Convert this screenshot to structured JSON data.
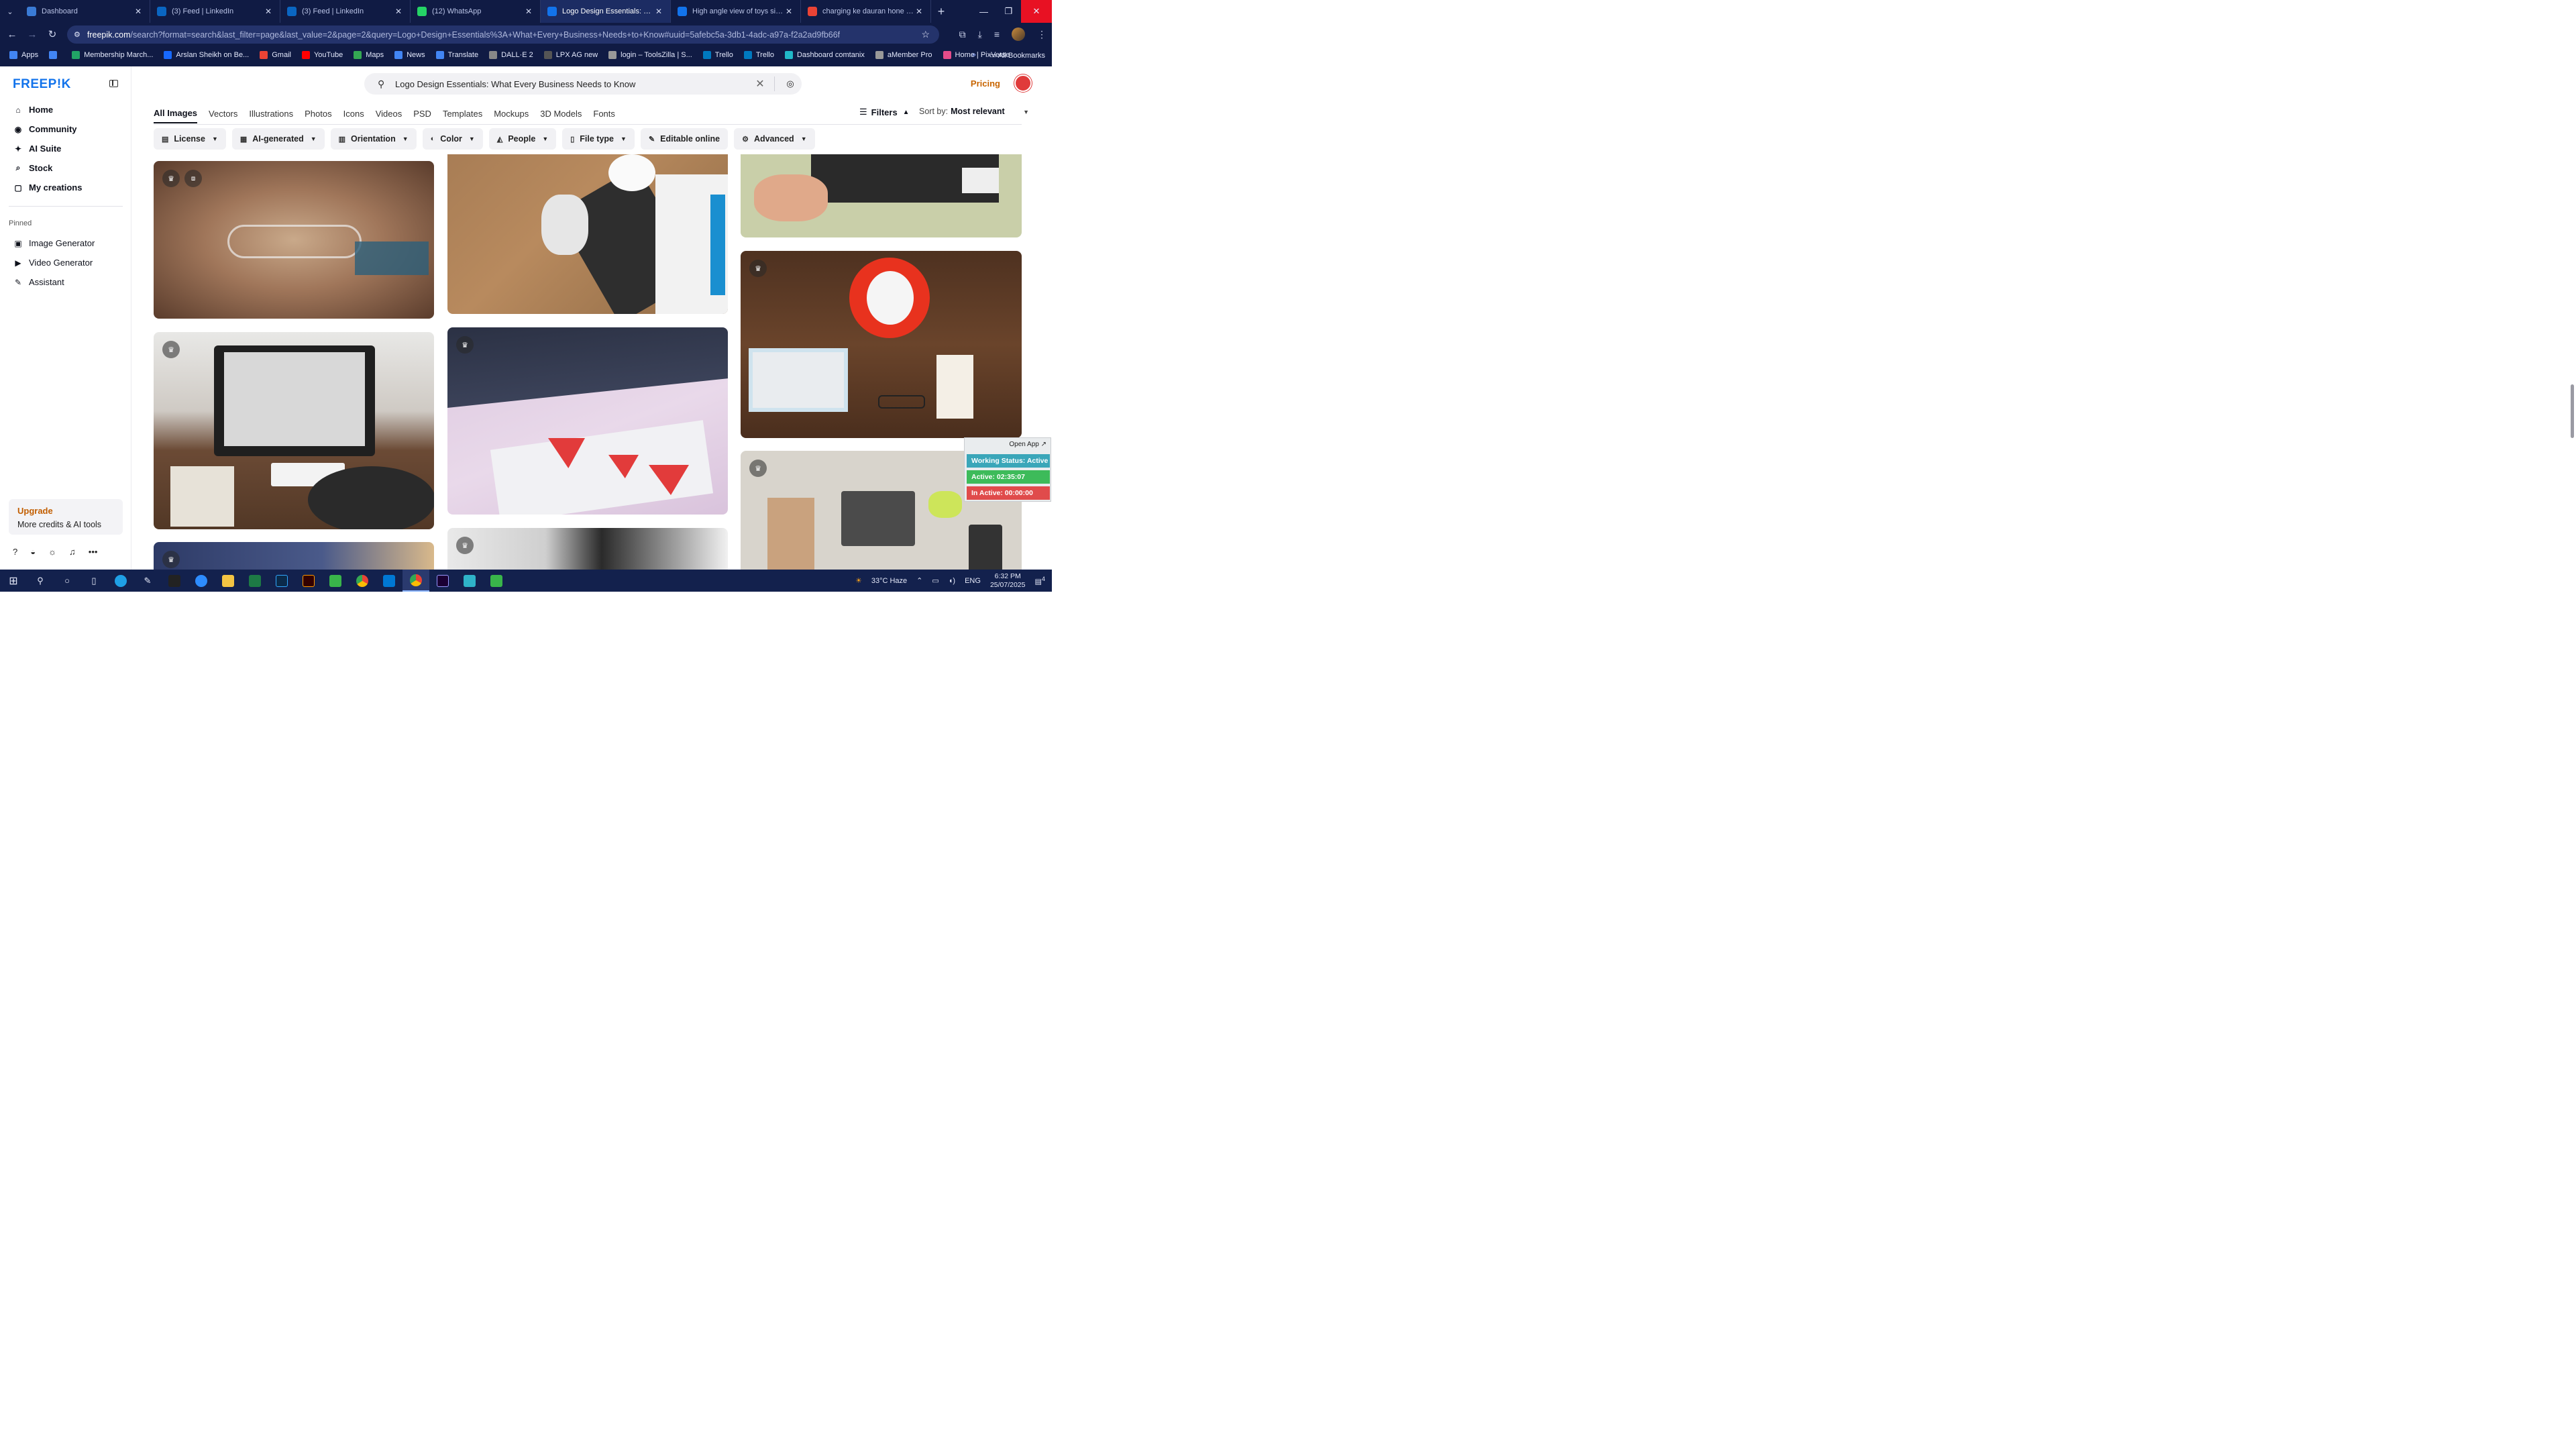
{
  "browser": {
    "tabs": [
      {
        "title": "Dashboard",
        "color": "#3a7bd5"
      },
      {
        "title": "(3) Feed | LinkedIn",
        "color": "#0a66c2"
      },
      {
        "title": "(3) Feed | LinkedIn",
        "color": "#0a66c2"
      },
      {
        "title": "(12) WhatsApp",
        "color": "#25d366"
      },
      {
        "title": "Logo Design Essentials: What Every",
        "color": "#1273eb"
      },
      {
        "title": "High angle view of toys sign | Fr",
        "color": "#1273eb"
      },
      {
        "title": "charging ke dauran hone ka use",
        "color": "#ea4335"
      }
    ],
    "active_tab_index": 4,
    "url_site": "freepik.com",
    "url_rest": "/search?format=search&last_filter=page&last_value=2&page=2&query=Logo+Design+Essentials%3A+What+Every+Business+Needs+to+Know#uuid=5afebc5a-3db1-4adc-a97a-f2a2ad9fb66f",
    "bookmarks": [
      {
        "label": "Apps",
        "color": "#4285f4"
      },
      {
        "label": "",
        "color": "#4285f4"
      },
      {
        "label": "Membership March...",
        "color": "#21a366"
      },
      {
        "label": "Arslan Sheikh on Be...",
        "color": "#1769ff"
      },
      {
        "label": "Gmail",
        "color": "#ea4335"
      },
      {
        "label": "YouTube",
        "color": "#ff0000"
      },
      {
        "label": "Maps",
        "color": "#34a853"
      },
      {
        "label": "News",
        "color": "#4285f4"
      },
      {
        "label": "Translate",
        "color": "#4285f4"
      },
      {
        "label": "DALL·E 2",
        "color": "#888888"
      },
      {
        "label": "LPX AG new",
        "color": "#555555"
      },
      {
        "label": "login – ToolsZilla | S...",
        "color": "#999999"
      },
      {
        "label": "Trello",
        "color": "#0079bf"
      },
      {
        "label": "Trello",
        "color": "#0079bf"
      },
      {
        "label": "Dashboard comtanix",
        "color": "#21b8c8"
      },
      {
        "label": "aMember Pro",
        "color": "#999999"
      },
      {
        "label": "Home | PixVerse",
        "color": "#e44c8a"
      }
    ],
    "all_bookmarks": "All Bookmarks"
  },
  "sidebar": {
    "logo": "FREEP!K",
    "nav": [
      {
        "label": "Home",
        "icon": "⌂"
      },
      {
        "label": "Community",
        "icon": "◉"
      },
      {
        "label": "AI Suite",
        "icon": "✦"
      },
      {
        "label": "Stock",
        "icon": "⌕"
      },
      {
        "label": "My creations",
        "icon": "▢"
      }
    ],
    "pinned_heading": "Pinned",
    "pinned": [
      {
        "label": "Image Generator",
        "icon": "▣"
      },
      {
        "label": "Video Generator",
        "icon": "▶"
      },
      {
        "label": "Assistant",
        "icon": "✎"
      }
    ],
    "upgrade_title": "Upgrade",
    "upgrade_sub": "More credits & AI tools"
  },
  "header": {
    "search_query": "Logo Design Essentials: What Every Business Needs to Know",
    "pricing": "Pricing"
  },
  "type_tabs": [
    "All Images",
    "Vectors",
    "Illustrations",
    "Photos",
    "Icons",
    "Videos",
    "PSD",
    "Templates",
    "Mockups",
    "3D Models",
    "Fonts"
  ],
  "filters": {
    "label": "Filters",
    "sort_label": "Sort by:",
    "sort_value": "Most relevant",
    "chips": [
      {
        "label": "License",
        "icon": "▤"
      },
      {
        "label": "AI-generated",
        "icon": "▦"
      },
      {
        "label": "Orientation",
        "icon": "▥"
      },
      {
        "label": "Color",
        "icon": "◐"
      },
      {
        "label": "People",
        "icon": "◭"
      },
      {
        "label": "File type",
        "icon": "▯"
      },
      {
        "label": "Editable online",
        "icon": "✎"
      },
      {
        "label": "Advanced",
        "icon": "⚙"
      }
    ]
  },
  "widget": {
    "open_app": "Open App ↗",
    "status": "Working Status: Active",
    "active": "Active: 02:35:07",
    "inactive": "In Active: 00:00:00"
  },
  "taskbar": {
    "weather": "33°C  Haze",
    "lang": "ENG",
    "time": "6:32 PM",
    "date": "25/07/2025",
    "notifications": "4"
  }
}
